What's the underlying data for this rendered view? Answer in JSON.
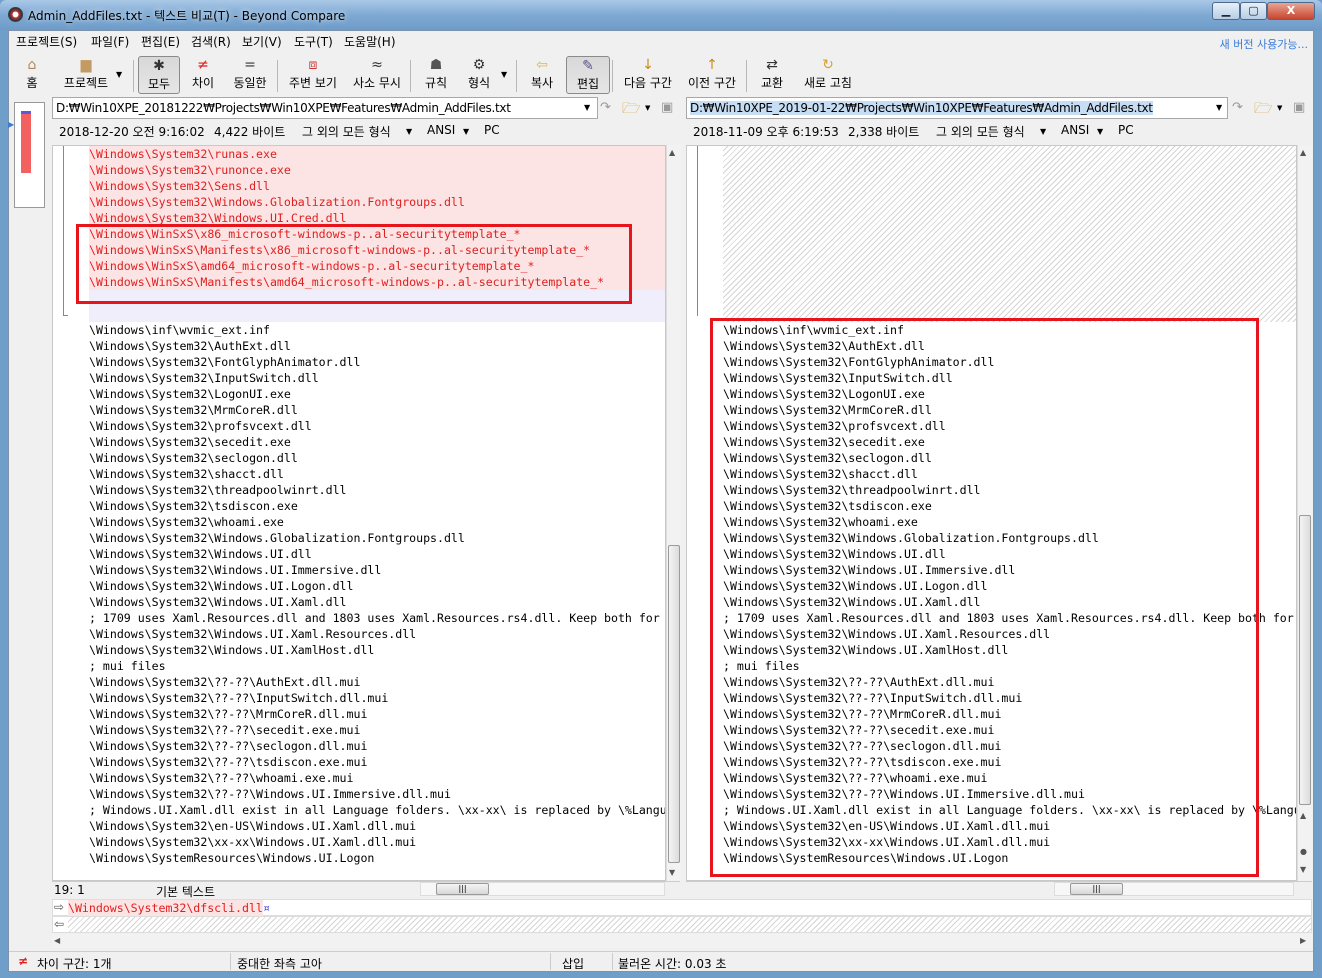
{
  "window": {
    "title": "Admin_AddFiles.txt - 텍스트 비교(T) - Beyond Compare",
    "minimize": "▁",
    "maximize": "▢",
    "close": "X"
  },
  "menu": [
    "프로젝트(S)",
    "파일(F)",
    "편집(E)",
    "검색(R)",
    "보기(V)",
    "도구(T)",
    "도움말(H)"
  ],
  "new_version": "새 버전 사용가능...",
  "toolbar": [
    {
      "id": "home",
      "label": "홈",
      "icon": "home-icon",
      "glyph": "⌂"
    },
    {
      "id": "project",
      "label": "프로젝트",
      "icon": "briefcase-icon",
      "glyph": "▆"
    },
    {
      "id": "all",
      "label": "모두",
      "icon": "asterisk-icon",
      "glyph": "✱",
      "pressed": true
    },
    {
      "id": "diffs",
      "label": "차이",
      "icon": "not-equal-icon",
      "glyph": "≠"
    },
    {
      "id": "same",
      "label": "동일한",
      "icon": "equal-icon",
      "glyph": "="
    },
    {
      "id": "context",
      "label": "주변 보기",
      "icon": "context-icon",
      "glyph": "⧈"
    },
    {
      "id": "minor",
      "label": "사소 무시",
      "icon": "approx-icon",
      "glyph": "≈"
    },
    {
      "id": "rules",
      "label": "규칙",
      "icon": "referee-icon",
      "glyph": "☗"
    },
    {
      "id": "format",
      "label": "형식",
      "icon": "format-gear-icon",
      "glyph": "⚙"
    },
    {
      "id": "copy",
      "label": "복사",
      "icon": "arrow-left-icon",
      "glyph": "⇦"
    },
    {
      "id": "edit",
      "label": "편집",
      "icon": "pencil-icon",
      "glyph": "✎",
      "pressed": true
    },
    {
      "id": "next",
      "label": "다음 구간",
      "icon": "arrow-down-icon",
      "glyph": "↓"
    },
    {
      "id": "prev",
      "label": "이전 구간",
      "icon": "arrow-up-icon",
      "glyph": "↑"
    },
    {
      "id": "swap",
      "label": "교환",
      "icon": "swap-icon",
      "glyph": "⇄"
    },
    {
      "id": "refresh",
      "label": "새로 고침",
      "icon": "refresh-icon",
      "glyph": "↻"
    }
  ],
  "left": {
    "path": "D:₩Win10XPE_20181222₩Projects₩Win10XPE₩Features₩Admin_AddFiles.txt",
    "date": "2018-12-20 오전 9:16:02",
    "size": "4,422 바이트",
    "format": "그 외의 모든 형식",
    "encoding": "ANSI",
    "lineend": "PC",
    "diff_lines": [
      "\\Windows\\System32\\runas.exe",
      "\\Windows\\System32\\runonce.exe",
      "\\Windows\\System32\\Sens.dll",
      "\\Windows\\System32\\Windows.Globalization.Fontgroups.dll",
      "\\Windows\\System32\\Windows.UI.Cred.dll",
      "\\Windows\\WinSxS\\x86_microsoft-windows-p..al-securitytemplate_*",
      "\\Windows\\WinSxS\\Manifests\\x86_microsoft-windows-p..al-securitytemplate_*",
      "\\Windows\\WinSxS\\amd64_microsoft-windows-p..al-securitytemplate_*",
      "\\Windows\\WinSxS\\Manifests\\amd64_microsoft-windows-p..al-securitytemplate_*"
    ],
    "cursor": "19: 1",
    "syntax": "기본 텍스트"
  },
  "right": {
    "path": "D:₩Win10XPE_2019-01-22₩Projects₩Win10XPE₩Features₩Admin_AddFiles.txt",
    "date": "2018-11-09 오후 6:19:53",
    "size": "2,338 바이트",
    "format": "그 외의 모든 형식",
    "encoding": "ANSI",
    "lineend": "PC"
  },
  "common_lines": [
    "\\Windows\\inf\\wvmic_ext.inf",
    "\\Windows\\System32\\AuthExt.dll",
    "\\Windows\\System32\\FontGlyphAnimator.dll",
    "\\Windows\\System32\\InputSwitch.dll",
    "\\Windows\\System32\\LogonUI.exe",
    "\\Windows\\System32\\MrmCoreR.dll",
    "\\Windows\\System32\\profsvcext.dll",
    "\\Windows\\System32\\secedit.exe",
    "\\Windows\\System32\\seclogon.dll",
    "\\Windows\\System32\\shacct.dll",
    "\\Windows\\System32\\threadpoolwinrt.dll",
    "\\Windows\\System32\\tsdiscon.exe",
    "\\Windows\\System32\\whoami.exe",
    "\\Windows\\System32\\Windows.Globalization.Fontgroups.dll",
    "\\Windows\\System32\\Windows.UI.dll",
    "\\Windows\\System32\\Windows.UI.Immersive.dll",
    "\\Windows\\System32\\Windows.UI.Logon.dll",
    "\\Windows\\System32\\Windows.UI.Xaml.dll",
    "; 1709 uses Xaml.Resources.dll and 1803 uses Xaml.Resources.rs4.dll. Keep both for",
    "\\Windows\\System32\\Windows.UI.Xaml.Resources.dll",
    "\\Windows\\System32\\Windows.UI.XamlHost.dll",
    "; mui files",
    "\\Windows\\System32\\??-??\\AuthExt.dll.mui",
    "\\Windows\\System32\\??-??\\InputSwitch.dll.mui",
    "\\Windows\\System32\\??-??\\MrmCoreR.dll.mui",
    "\\Windows\\System32\\??-??\\secedit.exe.mui",
    "\\Windows\\System32\\??-??\\seclogon.dll.mui",
    "\\Windows\\System32\\??-??\\tsdiscon.exe.mui",
    "\\Windows\\System32\\??-??\\whoami.exe.mui",
    "\\Windows\\System32\\??-??\\Windows.UI.Immersive.dll.mui",
    "; Windows.UI.Xaml.dll exist in all Language folders. \\xx-xx\\ is replaced by \\%Language",
    "\\Windows\\System32\\en-US\\Windows.UI.Xaml.dll.mui",
    "\\Windows\\System32\\xx-xx\\Windows.UI.Xaml.dll.mui",
    "\\Windows\\SystemResources\\Windows.UI.Logon"
  ],
  "line_detail": {
    "left": "\\Windows\\System32\\dfscli.dll",
    "eol_marker": "¤"
  },
  "statusbar": {
    "diff_count": "차이 구간: 1개",
    "mode": "중대한 좌측 고아",
    "insert": "삽입",
    "load_time": "불러온 시간: 0.03 초"
  },
  "colors": {
    "diff_text": "#e02020",
    "diff_bg": "#fde4e4",
    "highlight_box": "#e8141c",
    "link": "#3a7bd5"
  }
}
